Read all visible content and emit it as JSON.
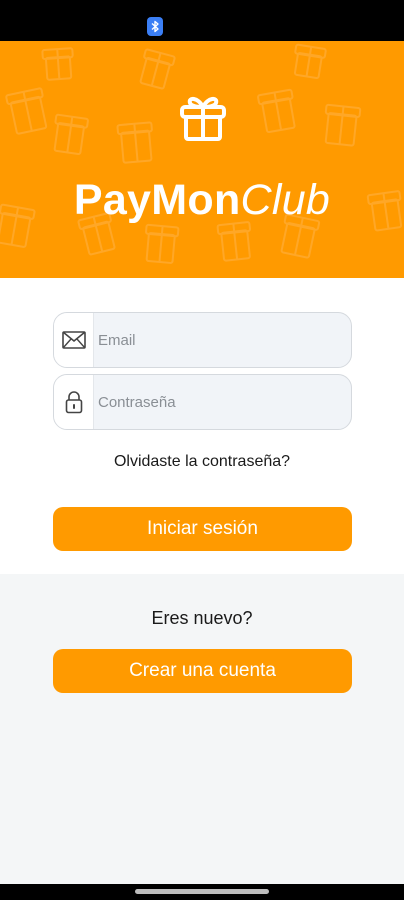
{
  "status_bar": {
    "icons": [
      "bluetooth-icon"
    ]
  },
  "header": {
    "logo_icon": "gift-icon",
    "brand_primary": "PayMon",
    "brand_secondary": "Club",
    "background_color": "#ff9a00"
  },
  "login_form": {
    "email": {
      "placeholder": "Email",
      "value": "",
      "icon": "envelope-icon"
    },
    "password": {
      "placeholder": "Contraseña",
      "value": "",
      "icon": "lock-icon"
    },
    "forgot_password_label": "Olvidaste la contraseña?",
    "login_button_label": "Iniciar sesión"
  },
  "signup": {
    "prompt": "Eres nuevo?",
    "create_account_label": "Crear una cuenta"
  },
  "colors": {
    "accent": "#ff9a00",
    "field_bg": "#f1f4f8",
    "lower_bg": "#f4f6f7"
  }
}
